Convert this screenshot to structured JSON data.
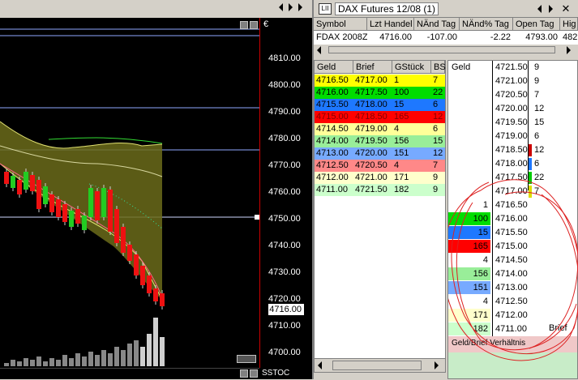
{
  "chart": {
    "currency": "€",
    "axis_labels": [
      "4810.00",
      "4800.00",
      "4790.00",
      "4780.00",
      "4770.00",
      "4760.00",
      "4750.00",
      "4740.00",
      "4730.00",
      "4720.00",
      "4710.00",
      "4700.00"
    ],
    "last_price": "4716.00",
    "bottom_label": "SSTOC"
  },
  "window": {
    "icon_label": "LII",
    "title": "DAX Futures 12/08 (1)",
    "close_glyph": "✕"
  },
  "quote": {
    "headers": [
      "Symbol",
      "Lzt Handel",
      "NÄnd Tag",
      "NÄnd% Tag",
      "Open Tag",
      "Hig"
    ],
    "values": [
      "FDAX 2008Z",
      "4716.00",
      "-107.00",
      "-2.22",
      "4793.00",
      "482"
    ]
  },
  "book": {
    "headers": [
      "Geld",
      "Brief",
      "GStück",
      "BS"
    ],
    "rows": [
      {
        "bid": "4716.50",
        "ask": "4717.00",
        "gst": "1",
        "bs": "7",
        "color": "#ffff00",
        "textcolor": "#000000"
      },
      {
        "bid": "4716.00",
        "ask": "4717.50",
        "gst": "100",
        "bs": "22",
        "color": "#00dd00",
        "textcolor": "#000000"
      },
      {
        "bid": "4715.50",
        "ask": "4718.00",
        "gst": "15",
        "bs": "6",
        "color": "#1e78ff",
        "textcolor": "#000000"
      },
      {
        "bid": "4715.00",
        "ask": "4718.50",
        "gst": "165",
        "bs": "12",
        "color": "#ff0000",
        "textcolor": "#800000"
      },
      {
        "bid": "4714.50",
        "ask": "4719.00",
        "gst": "4",
        "bs": "6",
        "color": "#ffff99",
        "textcolor": "#000000"
      },
      {
        "bid": "4714.00",
        "ask": "4719.50",
        "gst": "156",
        "bs": "15",
        "color": "#99ee99",
        "textcolor": "#000000"
      },
      {
        "bid": "4713.00",
        "ask": "4720.00",
        "gst": "151",
        "bs": "12",
        "color": "#77aaff",
        "textcolor": "#000000"
      },
      {
        "bid": "4712.50",
        "ask": "4720.50",
        "gst": "4",
        "bs": "7",
        "color": "#ff8888",
        "textcolor": "#000000"
      },
      {
        "bid": "4712.00",
        "ask": "4721.00",
        "gst": "171",
        "bs": "9",
        "color": "#ffffcc",
        "textcolor": "#000000"
      },
      {
        "bid": "4711.00",
        "ask": "4721.50",
        "gst": "182",
        "bs": "9",
        "color": "#ccffcc",
        "textcolor": "#000000"
      }
    ]
  },
  "ladder": {
    "geld_header": "Geld",
    "brief_label": "Brief",
    "ratio_label": "Geld/Brief Verhältnis",
    "ask_rows": [
      {
        "price": "4721.50",
        "qty": "9",
        "bar": ""
      },
      {
        "price": "4721.00",
        "qty": "9",
        "bar": ""
      },
      {
        "price": "4720.50",
        "qty": "7",
        "bar": ""
      },
      {
        "price": "4720.00",
        "qty": "12",
        "bar": ""
      },
      {
        "price": "4719.50",
        "qty": "15",
        "bar": ""
      },
      {
        "price": "4719.00",
        "qty": "6",
        "bar": ""
      },
      {
        "price": "4718.50",
        "qty": "12",
        "bar": "#cc0000"
      },
      {
        "price": "4718.00",
        "qty": "6",
        "bar": "#1e78ff"
      },
      {
        "price": "4717.50",
        "qty": "22",
        "bar": "#00cc00"
      },
      {
        "price": "4717.00",
        "qty": "7",
        "bar": "#dddd00"
      }
    ],
    "bid_rows": [
      {
        "price": "4716.50",
        "qty": "1",
        "color": ""
      },
      {
        "price": "4716.00",
        "qty": "100",
        "color": "#00dd00"
      },
      {
        "price": "4715.50",
        "qty": "15",
        "color": "#1e78ff"
      },
      {
        "price": "4715.00",
        "qty": "165",
        "color": "#ff0000"
      },
      {
        "price": "4714.50",
        "qty": "4",
        "color": ""
      },
      {
        "price": "4714.00",
        "qty": "156",
        "color": "#99ee99"
      },
      {
        "price": "4713.00",
        "qty": "151",
        "color": "#77aaff"
      },
      {
        "price": "4712.50",
        "qty": "4",
        "color": ""
      },
      {
        "price": "4712.00",
        "qty": "171",
        "color": "#ffffcc"
      },
      {
        "price": "4711.00",
        "qty": "182",
        "color": "#ccffcc"
      }
    ]
  }
}
